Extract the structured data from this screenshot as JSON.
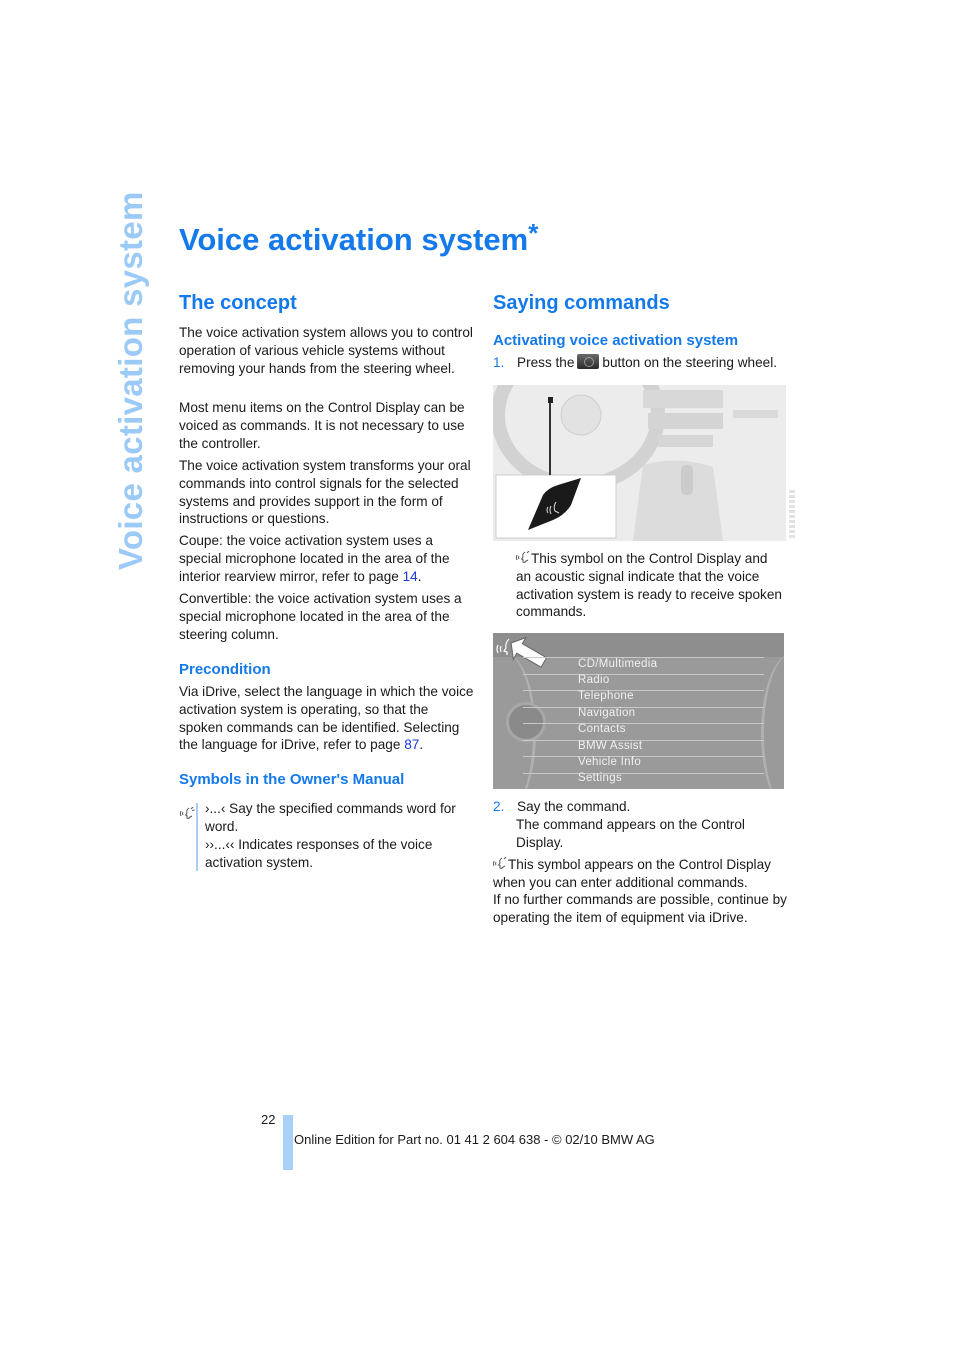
{
  "side_tab": {
    "label": "Voice activation system"
  },
  "title": {
    "text": "Voice activation system",
    "star": "*"
  },
  "left": {
    "heading": "The concept",
    "paragraphs": [
      "The voice activation system allows you to control operation of various vehicle systems without removing your hands from the steering wheel.",
      "Most menu items on the Control Display can be voiced as commands. It is not necessary to use the controller.",
      "The voice activation system transforms your oral commands into control signals for the selected systems and provides support in the form of instructions or questions."
    ],
    "coupe": {
      "text": "Coupe: the voice activation system uses a special microphone located in the area of the interior rearview mirror, refer to page ",
      "page_link": "14",
      "end": "."
    },
    "convertible": "Convertible: the voice activation system uses a special microphone located in the area of the steering column.",
    "precondition": {
      "heading": "Precondition",
      "text": "Via iDrive, select the language in which the voice activation system is operating, so that the spoken commands can be identified. Selecting the language for iDrive, refer to page ",
      "page_link": "87",
      "end": "."
    },
    "symbols": {
      "heading": "Symbols in the Owner's Manual",
      "line1": "›...‹ Say the specified commands word for word.",
      "line2": "››...‹‹ Indicates responses of the voice activation system."
    }
  },
  "right": {
    "heading": "Saying commands",
    "subheading": "Activating voice activation system",
    "step1": {
      "num": "1.",
      "pre": "Press the",
      "post": "button on the steering wheel."
    },
    "symbol_note1": "This symbol on the Control Display and an acoustic signal indicate that the voice activation system is ready to receive spoken commands.",
    "menu_items": [
      "CD/Multimedia",
      "Radio",
      "Telephone",
      "Navigation",
      "Contacts",
      "BMW Assist",
      "Vehicle Info",
      "Settings"
    ],
    "step2": {
      "num": "2.",
      "text": "Say the command.",
      "sub": "The command appears on the Control Display."
    },
    "symbol_note2": "This symbol appears on the Control Display when you can enter additional commands.",
    "final": "If no further commands are possible, continue by operating the item of equipment via iDrive."
  },
  "footer": {
    "page_number": "22",
    "text": "Online Edition for Part no. 01 41 2 604 638 - © 02/10 BMW AG"
  }
}
